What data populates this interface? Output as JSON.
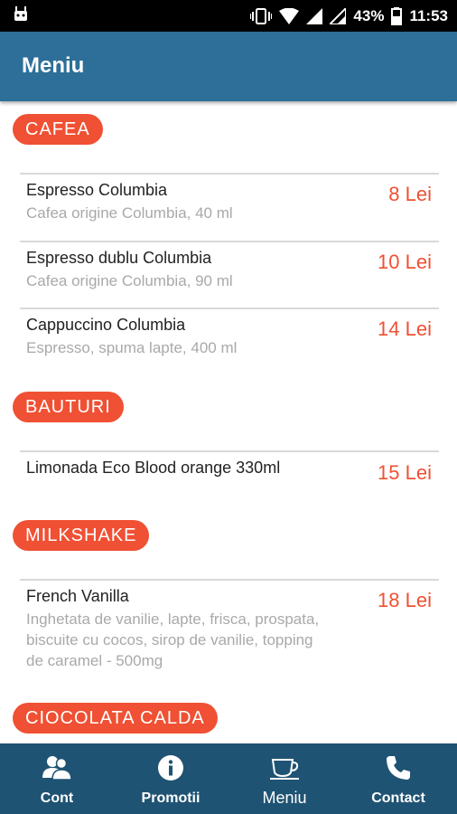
{
  "status_bar": {
    "battery": "43%",
    "time": "11:53"
  },
  "app_bar": {
    "title": "Meniu"
  },
  "sections": [
    {
      "title": "CAFEA",
      "items": [
        {
          "name": "Espresso Columbia",
          "description": "Cafea origine Columbia, 40 ml",
          "price": "8 Lei"
        },
        {
          "name": "Espresso dublu Columbia",
          "description": "Cafea origine Columbia, 90 ml",
          "price": "10 Lei"
        },
        {
          "name": "Cappuccino Columbia",
          "description": "Espresso, spuma lapte, 400 ml",
          "price": "14 Lei"
        }
      ]
    },
    {
      "title": "BAUTURI",
      "items": [
        {
          "name": "Limonada Eco Blood orange 330ml",
          "description": "",
          "price": "15 Lei"
        }
      ]
    },
    {
      "title": "MILKSHAKE",
      "items": [
        {
          "name": "French Vanilla",
          "description": "Inghetata de vanilie, lapte, frisca, prospata, biscuite cu cocos, sirop de vanilie, topping de caramel - 500mg",
          "price": "18 Lei"
        }
      ]
    },
    {
      "title": "CIOCOLATA CALDA",
      "items": []
    }
  ],
  "bottom_nav": [
    {
      "label": "Cont",
      "icon": "users-icon"
    },
    {
      "label": "Promotii",
      "icon": "info-icon"
    },
    {
      "label": "Meniu",
      "icon": "coffee-cup-icon",
      "active": true
    },
    {
      "label": "Contact",
      "icon": "phone-icon"
    }
  ],
  "colors": {
    "app_bar": "#2d6f98",
    "bottom_nav": "#1f5373",
    "accent": "#f05033",
    "description": "#a9a9a9"
  }
}
